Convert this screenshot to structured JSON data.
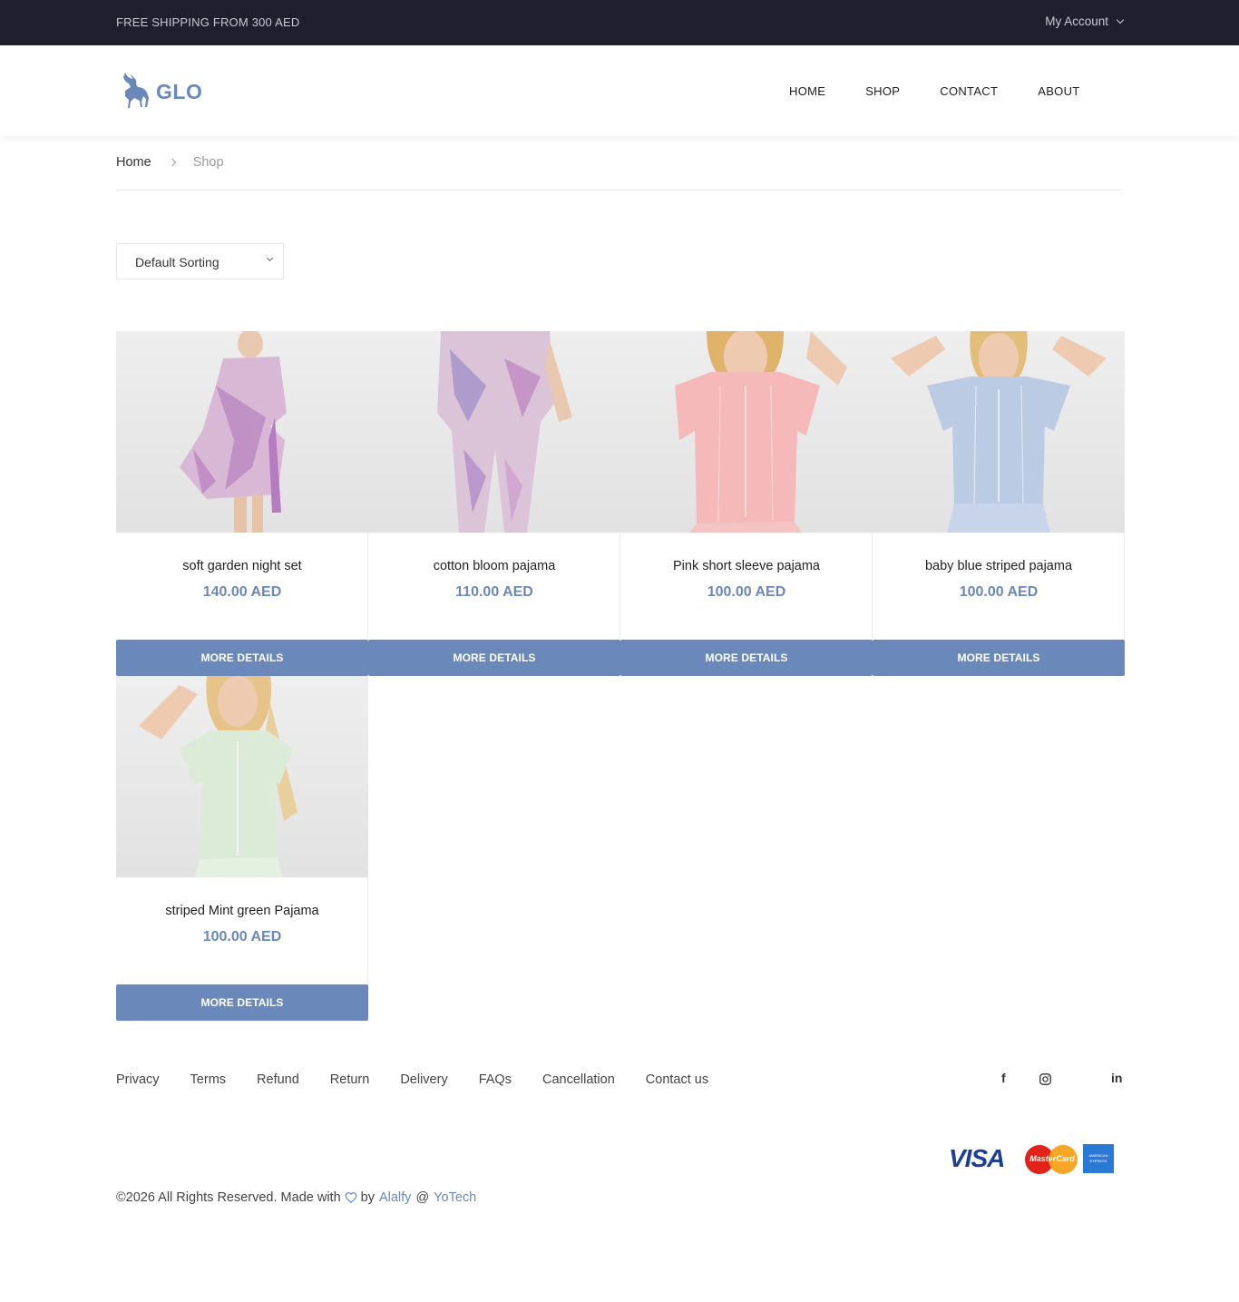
{
  "topbar": {
    "promo": "FREE SHIPPING FROM 300 AED",
    "account": "My Account"
  },
  "brand": {
    "name": "GLO",
    "color": "#6a88b9"
  },
  "nav": [
    {
      "label": "HOME"
    },
    {
      "label": "SHOP"
    },
    {
      "label": "CONTACT"
    },
    {
      "label": "ABOUT"
    }
  ],
  "breadcrumb": {
    "home": "Home",
    "current": "Shop"
  },
  "sorting": {
    "selected": "Default Sorting"
  },
  "products": [
    {
      "title": "soft garden night set",
      "price": "140.00 AED",
      "button": "MORE DETAILS"
    },
    {
      "title": "cotton bloom pajama",
      "price": "110.00 AED",
      "button": "MORE DETAILS"
    },
    {
      "title": "Pink short sleeve pajama",
      "price": "100.00 AED",
      "button": "MORE DETAILS"
    },
    {
      "title": "baby blue striped pajama",
      "price": "100.00 AED",
      "button": "MORE DETAILS"
    },
    {
      "title": "striped Mint green Pajama",
      "price": "100.00 AED",
      "button": "MORE DETAILS"
    }
  ],
  "footer": {
    "links": [
      "Privacy",
      "Terms",
      "Refund",
      "Return",
      "Delivery",
      "FAQs",
      "Cancellation",
      "Contact us"
    ],
    "social": {
      "facebook": "f",
      "linkedin": "in"
    },
    "payments": {
      "visa": "VISA",
      "mastercard": "MasterCard",
      "amex_line1": "AMERICAN",
      "amex_line2": "EXPRESS"
    },
    "copyright_prefix": "©2026 All Rights Reserved. Made with",
    "copyright_by": "by",
    "author": "Alalfy",
    "at": "@",
    "company": "YoTech"
  },
  "icons": {
    "account_dropdown": "chevron-down-icon",
    "breadcrumb_separator": "chevron-right-icon",
    "sorting_dropdown": "chevron-down-icon",
    "heart": "heart-icon",
    "instagram": "instagram-icon"
  }
}
